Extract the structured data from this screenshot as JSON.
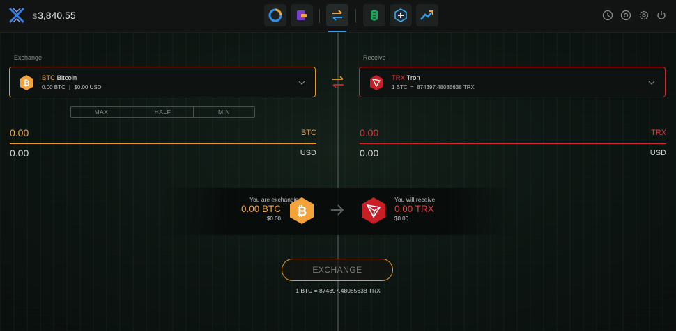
{
  "header": {
    "balance_currency": "$",
    "balance_value": "3,840.55"
  },
  "nav": {
    "icons": [
      "portfolio-icon",
      "wallet-icon",
      "exchange-icon",
      "staking-icon",
      "add-asset-icon",
      "trending-icon"
    ],
    "right_icons": [
      "history-icon",
      "support-icon",
      "settings-icon",
      "power-icon"
    ]
  },
  "exchange": {
    "label": "Exchange",
    "symbol": "BTC",
    "name": "Bitcoin",
    "balance": "0.00 BTC",
    "balance_sep": "|",
    "balance_usd": "$0.00 USD",
    "max_label": "MAX",
    "half_label": "HALF",
    "min_label": "MIN",
    "amount": "0.00",
    "amount_unit": "BTC",
    "usd_amount": "0.00",
    "usd_unit": "USD"
  },
  "receive": {
    "label": "Receive",
    "symbol": "TRX",
    "name": "Tron",
    "rate_text": "1 BTC  =  874397.48085638 TRX",
    "amount": "0.00",
    "amount_unit": "TRX",
    "usd_amount": "0.00",
    "usd_unit": "USD"
  },
  "summary": {
    "exchanging_label": "You are exchanging",
    "exchanging_amount": "0.00 BTC",
    "exchanging_usd": "$0.00",
    "receive_label": "You will receive",
    "receive_amount": "0.00 TRX",
    "receive_usd": "$0.00"
  },
  "action": {
    "exchange_label": "EXCHANGE",
    "rate": "1 BTC = 874397.48085638 TRX"
  },
  "colors": {
    "btc": "#f4a23a",
    "trx": "#e53a3f",
    "accent": "#3aa0e8"
  }
}
